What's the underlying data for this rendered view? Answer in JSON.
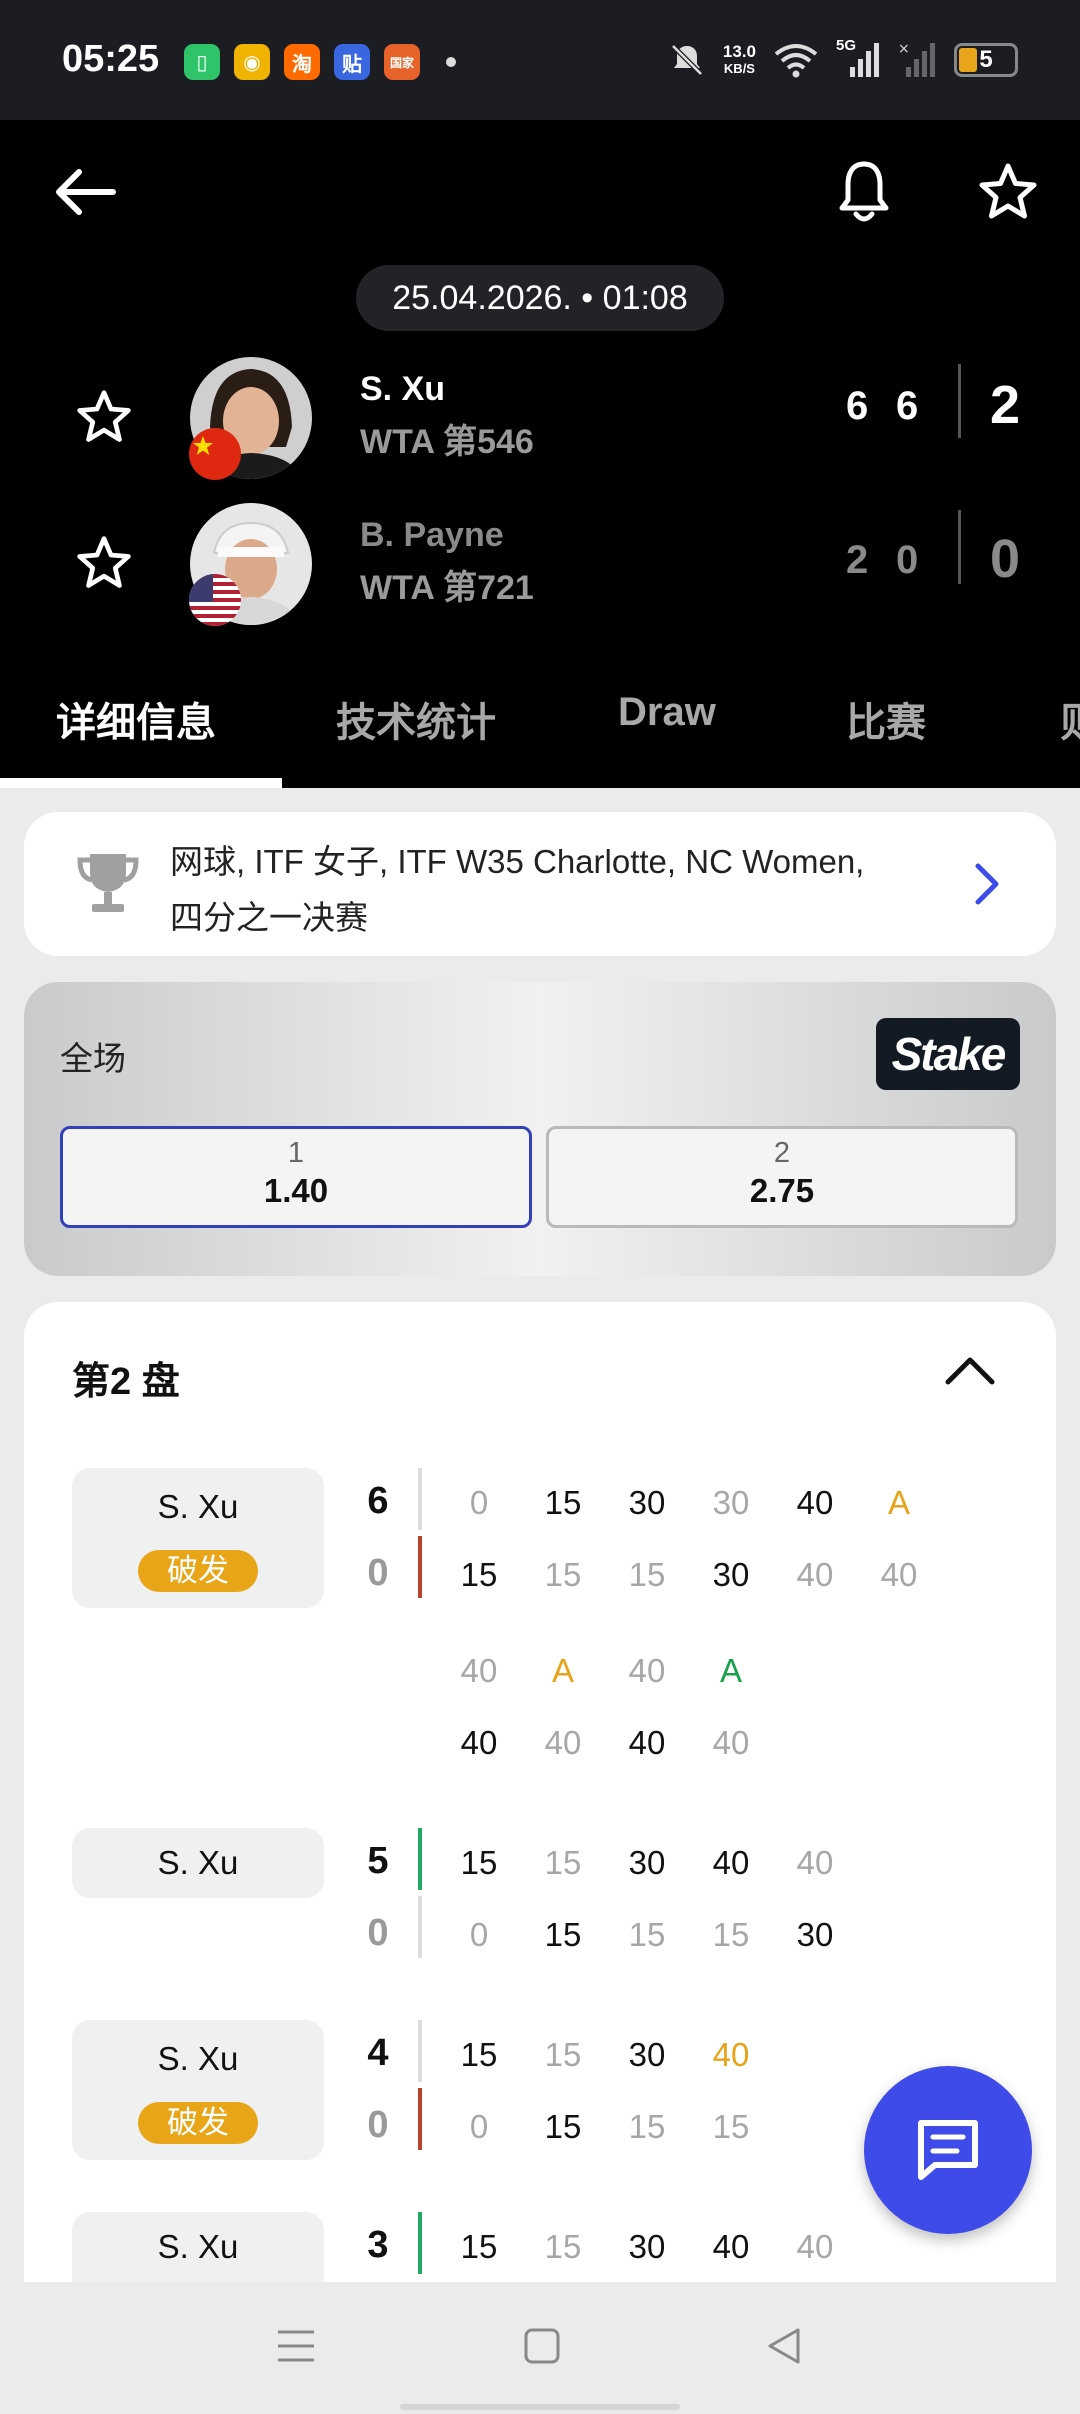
{
  "status_bar": {
    "time": "05:25",
    "network_speed_value": "13.0",
    "network_speed_unit": "KB/S",
    "network_type": "5G",
    "battery": "5",
    "apps": [
      "app-icon",
      "weibo-icon",
      "taobao-icon",
      "tieba-icon",
      "gov-app-icon"
    ]
  },
  "match": {
    "datetime": "25.04.2026. • 01:08",
    "players": [
      {
        "name": "S. Xu",
        "rank": "WTA 第546",
        "sets": [
          "6",
          "6"
        ],
        "total": "2",
        "flag": "China"
      },
      {
        "name": "B. Payne",
        "rank": "WTA 第721",
        "sets": [
          "2",
          "0"
        ],
        "total": "0",
        "flag": "USA"
      }
    ]
  },
  "tabs": [
    "详细信息",
    "技术统计",
    "Draw",
    "比赛",
    "则"
  ],
  "competition": {
    "line1": "网球, ITF 女子, ITF W35 Charlotte, NC Women,",
    "line2": "四分之一决赛"
  },
  "odds": {
    "title": "全场",
    "bookmaker": "Stake",
    "options": [
      {
        "label": "1",
        "value": "1.40",
        "selected": true
      },
      {
        "label": "2",
        "value": "2.75",
        "selected": false
      }
    ]
  },
  "set_detail": {
    "title": "第2 盘",
    "break_label": "破发",
    "games": [
      {
        "server": "S. Xu",
        "break": true,
        "score_top": "6",
        "score_bottom": "0",
        "row1": [
          "0",
          "15",
          "30",
          "30",
          "40",
          "A"
        ],
        "row2": [
          "15",
          "15",
          "15",
          "30",
          "40",
          "40"
        ],
        "row3": [
          "40",
          "A",
          "40",
          "A"
        ],
        "row4": [
          "40",
          "40",
          "40",
          "40"
        ]
      },
      {
        "server": "S. Xu",
        "break": false,
        "score_top": "5",
        "score_bottom": "0",
        "row1": [
          "15",
          "15",
          "30",
          "40",
          "40"
        ],
        "row2": [
          "0",
          "15",
          "15",
          "15",
          "30"
        ]
      },
      {
        "server": "S. Xu",
        "break": true,
        "score_top": "4",
        "score_bottom": "0",
        "row1": [
          "15",
          "15",
          "30",
          "40"
        ],
        "row2": [
          "0",
          "15",
          "15",
          "15"
        ]
      },
      {
        "server": "S. Xu",
        "break": false,
        "score_top": "3",
        "row1": [
          "15",
          "15",
          "30",
          "40",
          "40"
        ]
      }
    ]
  },
  "colors": {
    "accent_blue": "#3e4be9",
    "break_orange": "#e8a517",
    "advantage_green": "#1aa14b",
    "serve_green": "#22a865",
    "break_red": "#b8422a"
  }
}
